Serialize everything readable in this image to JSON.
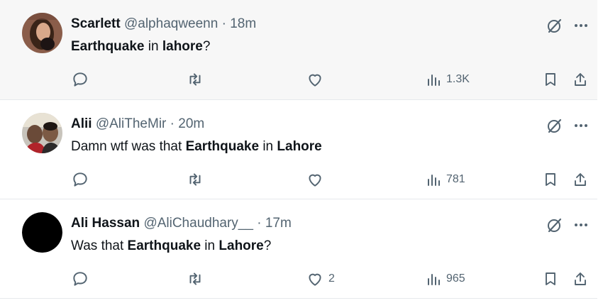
{
  "tweets": [
    {
      "name": "Scarlett",
      "handle": "@alphaqweenn",
      "dot": "·",
      "time": "18m",
      "text": [
        {
          "t": "Earthquake",
          "b": true
        },
        {
          "t": " in ",
          "b": false
        },
        {
          "t": "lahore",
          "b": true
        },
        {
          "t": "?",
          "b": false
        }
      ],
      "replies": "",
      "retweets": "",
      "likes": "",
      "views": "1.3K",
      "avatar": "avatar-woman-photo"
    },
    {
      "name": "Alii",
      "handle": "@AliTheMir",
      "dot": "·",
      "time": "20m",
      "text": [
        {
          "t": "Damn wtf was that ",
          "b": false
        },
        {
          "t": "Earthquake",
          "b": true
        },
        {
          "t": " in ",
          "b": false
        },
        {
          "t": "Lahore",
          "b": true
        }
      ],
      "replies": "",
      "retweets": "",
      "likes": "",
      "views": "781",
      "avatar": "avatar-two-men-photo"
    },
    {
      "name": "Ali Hassan",
      "handle": "@AliChaudhary__",
      "dot": "·",
      "time": "17m",
      "text": [
        {
          "t": "Was that ",
          "b": false
        },
        {
          "t": "Earthquake",
          "b": true
        },
        {
          "t": " in ",
          "b": false
        },
        {
          "t": "Lahore",
          "b": true
        },
        {
          "t": "?",
          "b": false
        }
      ],
      "replies": "",
      "retweets": "",
      "likes": "2",
      "views": "965",
      "avatar": "avatar-black-circle"
    }
  ],
  "colors": {
    "text": "#0f1419",
    "muted": "#536471",
    "hover_bg": "#f7f7f7",
    "divider": "#e6e9ec"
  },
  "icons": [
    "reply-icon",
    "retweet-icon",
    "like-icon",
    "views-icon",
    "bookmark-icon",
    "share-icon",
    "grok-icon",
    "more-icon"
  ]
}
